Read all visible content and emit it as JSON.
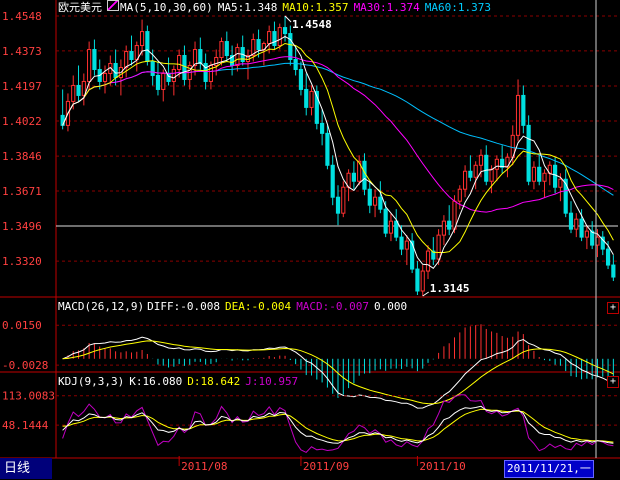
{
  "header": {
    "symbol": "欧元美元",
    "ma_icon": "ma-legend-icon",
    "ma_params": "MA(5,10,30,60)",
    "ma5": "MA5:1.348",
    "ma10": "MA10:1.357",
    "ma30": "MA30:1.374",
    "ma60": "MA60:1.373"
  },
  "macd_header": {
    "params": "MACD(26,12,9)",
    "diff": "DIFF:-0.008",
    "dea": "DEA:-0.004",
    "macd": "MACD:-0.007",
    "extra": "0.000"
  },
  "kdj_header": {
    "params": "KDJ(9,3,3)",
    "k": "K:16.080",
    "d": "D:18.642",
    "j": "J:10.957"
  },
  "footer": {
    "period_tab": "日线",
    "cursor_date": "2011/11/21,一"
  },
  "colors": {
    "up": "#ff3030",
    "down": "#00e0e0",
    "ma5": "#ffffff",
    "ma10": "#ffff00",
    "ma30": "#ff00ff",
    "ma60": "#00c0ff",
    "grid": "#8b0000",
    "axis": "#c00000",
    "diff": "#ffffff",
    "dea": "#ffff00",
    "k": "#ffffff",
    "d": "#ffff00",
    "j": "#c000c0"
  },
  "chart_data": [
    {
      "type": "candlestick",
      "title": "欧元美元",
      "y_ticks": [
        "1.4548",
        "1.4373",
        "1.4197",
        "1.4022",
        "1.3846",
        "1.3671",
        "1.3496",
        "1.3320"
      ],
      "ylim": [
        1.3145,
        1.4548
      ],
      "annotations": [
        {
          "text": "1.4548",
          "value": 1.4548,
          "index": 42
        },
        {
          "text": "1.3145",
          "value": 1.3145,
          "index": 68
        }
      ],
      "x_labels": [
        {
          "text": "2011/08",
          "index": 22
        },
        {
          "text": "2011/09",
          "index": 45
        },
        {
          "text": "2011/10",
          "index": 67
        }
      ],
      "ohlc": [
        [
          1.405,
          1.418,
          1.398,
          1.4
        ],
        [
          1.4,
          1.416,
          1.397,
          1.412
        ],
        [
          1.412,
          1.425,
          1.408,
          1.42
        ],
        [
          1.42,
          1.43,
          1.412,
          1.415
        ],
        [
          1.415,
          1.426,
          1.41,
          1.422
        ],
        [
          1.422,
          1.442,
          1.418,
          1.438
        ],
        [
          1.438,
          1.443,
          1.425,
          1.428
        ],
        [
          1.428,
          1.433,
          1.418,
          1.422
        ],
        [
          1.422,
          1.43,
          1.416,
          1.426
        ],
        [
          1.426,
          1.435,
          1.42,
          1.431
        ],
        [
          1.431,
          1.438,
          1.42,
          1.424
        ],
        [
          1.424,
          1.433,
          1.415,
          1.429
        ],
        [
          1.429,
          1.44,
          1.424,
          1.437
        ],
        [
          1.437,
          1.445,
          1.43,
          1.433
        ],
        [
          1.433,
          1.442,
          1.427,
          1.44
        ],
        [
          1.44,
          1.453,
          1.435,
          1.447
        ],
        [
          1.447,
          1.45,
          1.43,
          1.432
        ],
        [
          1.432,
          1.438,
          1.42,
          1.425
        ],
        [
          1.425,
          1.432,
          1.415,
          1.418
        ],
        [
          1.418,
          1.428,
          1.412,
          1.426
        ],
        [
          1.426,
          1.434,
          1.42,
          1.422
        ],
        [
          1.422,
          1.43,
          1.415,
          1.428
        ],
        [
          1.428,
          1.438,
          1.424,
          1.435
        ],
        [
          1.435,
          1.44,
          1.42,
          1.423
        ],
        [
          1.423,
          1.432,
          1.418,
          1.43
        ],
        [
          1.43,
          1.442,
          1.425,
          1.438
        ],
        [
          1.438,
          1.444,
          1.428,
          1.431
        ],
        [
          1.431,
          1.436,
          1.418,
          1.422
        ],
        [
          1.422,
          1.432,
          1.418,
          1.43
        ],
        [
          1.43,
          1.438,
          1.425,
          1.434
        ],
        [
          1.434,
          1.444,
          1.43,
          1.442
        ],
        [
          1.442,
          1.447,
          1.432,
          1.435
        ],
        [
          1.435,
          1.44,
          1.425,
          1.43
        ],
        [
          1.43,
          1.441,
          1.427,
          1.439
        ],
        [
          1.439,
          1.445,
          1.43,
          1.432
        ],
        [
          1.432,
          1.438,
          1.423,
          1.435
        ],
        [
          1.435,
          1.446,
          1.432,
          1.443
        ],
        [
          1.443,
          1.448,
          1.434,
          1.438
        ],
        [
          1.438,
          1.442,
          1.43,
          1.441
        ],
        [
          1.441,
          1.45,
          1.436,
          1.447
        ],
        [
          1.447,
          1.452,
          1.438,
          1.44
        ],
        [
          1.44,
          1.451,
          1.438,
          1.449
        ],
        [
          1.449,
          1.4548,
          1.442,
          1.446
        ],
        [
          1.446,
          1.45,
          1.43,
          1.433
        ],
        [
          1.433,
          1.44,
          1.425,
          1.428
        ],
        [
          1.428,
          1.432,
          1.415,
          1.418
        ],
        [
          1.418,
          1.426,
          1.405,
          1.409
        ],
        [
          1.409,
          1.42,
          1.405,
          1.417
        ],
        [
          1.417,
          1.42,
          1.398,
          1.401
        ],
        [
          1.401,
          1.408,
          1.39,
          1.396
        ],
        [
          1.396,
          1.4,
          1.378,
          1.38
        ],
        [
          1.38,
          1.385,
          1.36,
          1.364
        ],
        [
          1.364,
          1.37,
          1.35,
          1.356
        ],
        [
          1.356,
          1.372,
          1.354,
          1.369
        ],
        [
          1.369,
          1.378,
          1.362,
          1.376
        ],
        [
          1.376,
          1.382,
          1.368,
          1.372
        ],
        [
          1.372,
          1.385,
          1.37,
          1.382
        ],
        [
          1.382,
          1.386,
          1.365,
          1.368
        ],
        [
          1.368,
          1.372,
          1.356,
          1.36
        ],
        [
          1.36,
          1.368,
          1.354,
          1.364
        ],
        [
          1.364,
          1.372,
          1.356,
          1.358
        ],
        [
          1.358,
          1.362,
          1.344,
          1.346
        ],
        [
          1.346,
          1.356,
          1.342,
          1.352
        ],
        [
          1.352,
          1.358,
          1.342,
          1.344
        ],
        [
          1.344,
          1.35,
          1.335,
          1.338
        ],
        [
          1.338,
          1.345,
          1.33,
          1.342
        ],
        [
          1.342,
          1.346,
          1.326,
          1.328
        ],
        [
          1.328,
          1.332,
          1.315,
          1.317
        ],
        [
          1.317,
          1.33,
          1.3145,
          1.327
        ],
        [
          1.327,
          1.34,
          1.323,
          1.337
        ],
        [
          1.337,
          1.344,
          1.33,
          1.333
        ],
        [
          1.333,
          1.348,
          1.33,
          1.345
        ],
        [
          1.345,
          1.355,
          1.34,
          1.352
        ],
        [
          1.352,
          1.36,
          1.345,
          1.348
        ],
        [
          1.348,
          1.365,
          1.346,
          1.362
        ],
        [
          1.362,
          1.37,
          1.358,
          1.368
        ],
        [
          1.368,
          1.38,
          1.364,
          1.377
        ],
        [
          1.377,
          1.385,
          1.372,
          1.374
        ],
        [
          1.374,
          1.382,
          1.368,
          1.38
        ],
        [
          1.38,
          1.388,
          1.374,
          1.385
        ],
        [
          1.385,
          1.39,
          1.37,
          1.372
        ],
        [
          1.372,
          1.38,
          1.366,
          1.378
        ],
        [
          1.378,
          1.385,
          1.372,
          1.383
        ],
        [
          1.383,
          1.39,
          1.376,
          1.379
        ],
        [
          1.379,
          1.386,
          1.374,
          1.384
        ],
        [
          1.384,
          1.4,
          1.38,
          1.395
        ],
        [
          1.395,
          1.423,
          1.392,
          1.415
        ],
        [
          1.415,
          1.42,
          1.396,
          1.4
        ],
        [
          1.4,
          1.405,
          1.37,
          1.372
        ],
        [
          1.372,
          1.382,
          1.368,
          1.379
        ],
        [
          1.379,
          1.385,
          1.37,
          1.372
        ],
        [
          1.372,
          1.378,
          1.364,
          1.376
        ],
        [
          1.376,
          1.382,
          1.37,
          1.38
        ],
        [
          1.38,
          1.384,
          1.366,
          1.369
        ],
        [
          1.369,
          1.376,
          1.362,
          1.373
        ],
        [
          1.373,
          1.378,
          1.354,
          1.356
        ],
        [
          1.356,
          1.362,
          1.346,
          1.348
        ],
        [
          1.348,
          1.356,
          1.344,
          1.353
        ],
        [
          1.353,
          1.358,
          1.342,
          1.344
        ],
        [
          1.344,
          1.35,
          1.338,
          1.347
        ],
        [
          1.347,
          1.352,
          1.338,
          1.34
        ],
        [
          1.34,
          1.348,
          1.334,
          1.344
        ],
        [
          1.344,
          1.347,
          1.335,
          1.338
        ],
        [
          1.338,
          1.342,
          1.328,
          1.33
        ],
        [
          1.33,
          1.335,
          1.322,
          1.324
        ]
      ]
    },
    {
      "type": "bar-line",
      "title": "MACD(26,12,9)",
      "y_ticks": [
        "0.0150",
        "-0.0028"
      ],
      "ylim": [
        -0.005,
        0.02
      ],
      "series": [
        {
          "name": "DIFF"
        },
        {
          "name": "DEA"
        },
        {
          "name": "MACD"
        }
      ]
    },
    {
      "type": "line",
      "title": "KDJ(9,3,3)",
      "y_ticks": [
        "113.0083",
        "48.1444"
      ],
      "ylim": [
        -20,
        130
      ],
      "series": [
        {
          "name": "K"
        },
        {
          "name": "D"
        },
        {
          "name": "J"
        }
      ]
    }
  ]
}
